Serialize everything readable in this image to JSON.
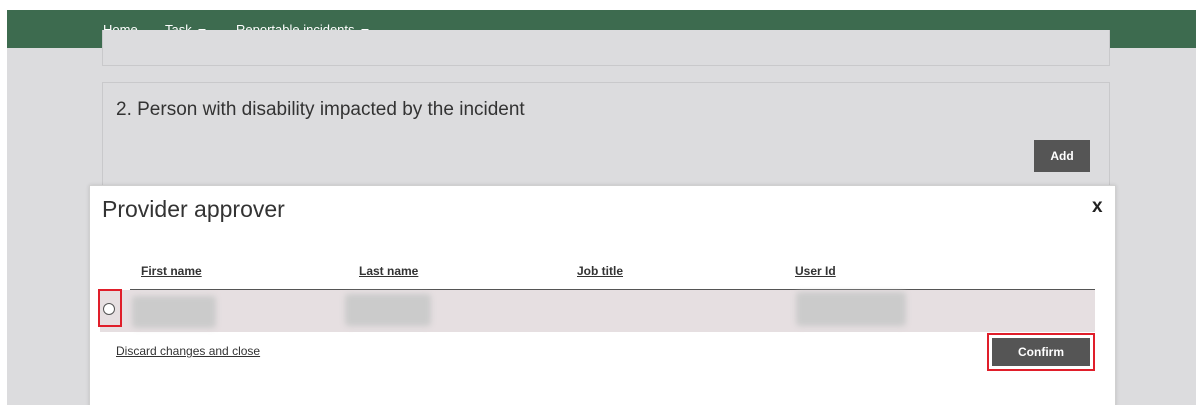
{
  "nav": {
    "home": "Home",
    "task": "Task",
    "reportable_incidents": "Reportable incidents"
  },
  "section2": {
    "title": "2. Person with disability impacted by the incident",
    "add_label": "Add"
  },
  "modal": {
    "title": "Provider approver",
    "close_label": "x",
    "columns": [
      "First name",
      "Last name",
      "Job title",
      "User Id"
    ],
    "discard_label": "Discard changes and close",
    "confirm_label": "Confirm"
  },
  "colors": {
    "nav_bar": "#3d6b4f",
    "button": "#555555",
    "highlight": "#e01e2a",
    "row_bg": "#e6dfe1"
  },
  "icons": {
    "task_dropdown": "chevron-down-icon",
    "incidents_dropdown": "chevron-down-icon",
    "close": "close-icon",
    "row_select": "radio-button"
  }
}
